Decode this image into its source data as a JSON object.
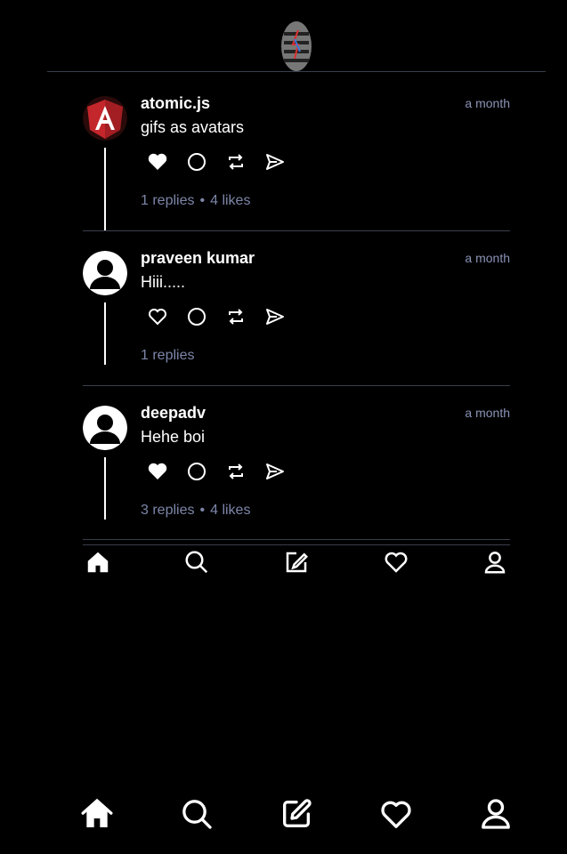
{
  "posts": [
    {
      "username": "atomic.js",
      "time": "a month",
      "content": "gifs as avatars",
      "replies": "1 replies",
      "likes": "4 likes",
      "avatar": "angular-logo-icon"
    },
    {
      "username": "praveen kumar",
      "time": "a month",
      "content": "Hiii.....",
      "replies": "1 replies",
      "likes": "",
      "avatar": "default-user-icon"
    },
    {
      "username": "deepadv",
      "time": "a month",
      "content": "Hehe boi",
      "replies": "3 replies",
      "likes": "4 likes",
      "avatar": "default-user-icon"
    }
  ],
  "stats_separator": "•",
  "actions": [
    "heart-icon",
    "comment-icon",
    "repost-icon",
    "share-icon"
  ],
  "nav": [
    "home-icon",
    "search-icon",
    "compose-icon",
    "activity-heart-icon",
    "profile-icon"
  ],
  "colors": {
    "background": "#000000",
    "muted": "#7d86a8",
    "divider": "#3a3f4c"
  }
}
